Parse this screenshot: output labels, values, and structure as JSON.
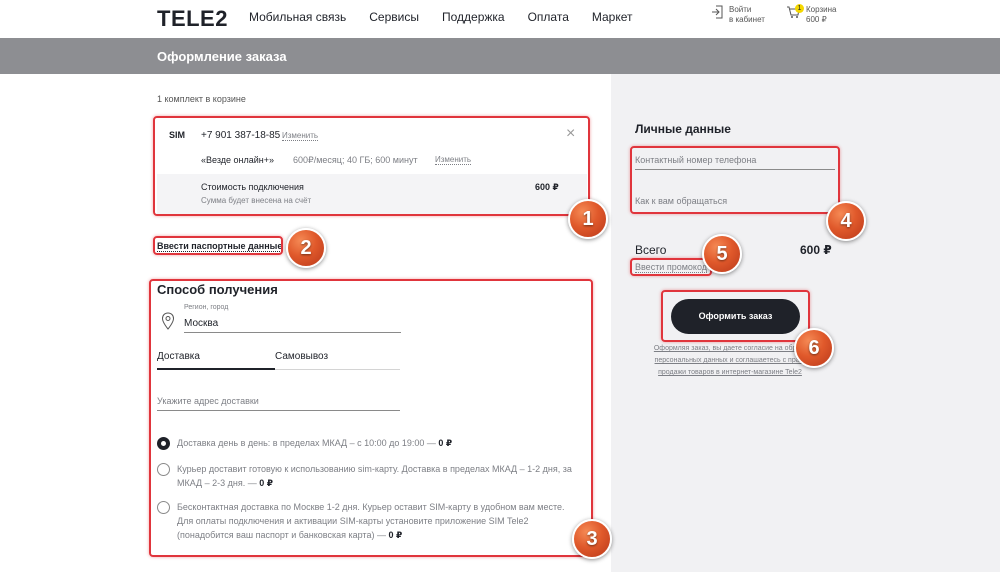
{
  "header": {
    "logo": "TELE2",
    "nav": [
      "Мобильная связь",
      "Сервисы",
      "Поддержка",
      "Оплата",
      "Маркет"
    ],
    "login_line1": "Войти",
    "login_line2": "в кабинет",
    "cart_line1": "Корзина",
    "cart_line2": "600 ₽",
    "cart_badge": "1"
  },
  "banner": {
    "title": "Оформление заказа"
  },
  "cart": {
    "count_text": "1 комплект в корзине",
    "sim_label": "SIM",
    "number": "+7 901 387-18-85",
    "change_label": "Изменить",
    "tariff_name": "«Везде онлайн+»",
    "tariff_desc": "600₽/месяц; 40 ГБ; 600 минут",
    "tariff_change_label": "Изменить",
    "cost_label": "Стоимость подключения",
    "cost_note": "Сумма будет внесена на счёт",
    "cost_value": "600 ₽",
    "close_symbol": "×"
  },
  "passport_link": "Ввести паспортные данные",
  "delivery": {
    "title": "Способ получения",
    "region_label": "Регион, город",
    "region_value": "Москва",
    "tabs": [
      "Доставка",
      "Самовывоз"
    ],
    "address_placeholder": "Укажите адрес доставки",
    "options": [
      {
        "text": "Доставка день в день: в пределах МКАД – с 10:00 до 19:00 —",
        "price": "0 ₽",
        "checked": true
      },
      {
        "text_line1": "Курьер доставит готовую к использованию sim-карту. Доставка в пределах МКАД – 1-2 дня, за",
        "text_line2": "МКАД – 2-3 дня. —",
        "price": "0 ₽",
        "checked": false
      },
      {
        "text_line1": "Бесконтактная доставка по Москве 1-2 дня. Курьер оставит SIM-карту в удобном вам месте.",
        "text_line2": "Для оплаты подключения и активации SIM-карты установите приложение SIM Tele2",
        "text_line3": "(понадобится ваш паспорт и банковская карта) —",
        "price": "0 ₽",
        "checked": false
      }
    ]
  },
  "personal": {
    "title": "Личные данные",
    "phone_placeholder": "Контактный номер телефона",
    "name_placeholder": "Как к вам обращаться"
  },
  "total": {
    "label": "Всего",
    "value": "600 ₽",
    "promo_link": "Ввести промокод"
  },
  "order_button": "Оформить заказ",
  "consent": {
    "line1": "Оформляя заказ, вы даете согласие на обра...",
    "line2": "персональных данных и соглашаетесь с пра...",
    "line3": "продажи товаров в интернет-магазине Tele2"
  },
  "steps": [
    "1",
    "2",
    "3",
    "4",
    "5",
    "6"
  ],
  "colors": {
    "accent_red": "#e0353c",
    "step_orange": "#e0592b",
    "banner_gray": "#8d8e92",
    "dark": "#1f2229"
  }
}
